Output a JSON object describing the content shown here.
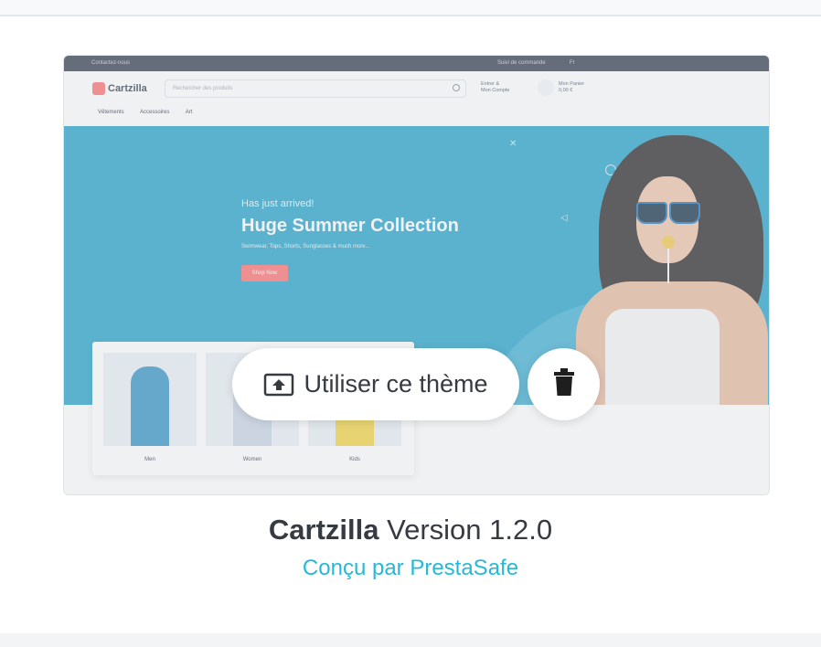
{
  "preview": {
    "topbar_left": "Contactez-nous",
    "topbar_track": "Suivi de commande",
    "topbar_lang": "Fr",
    "logo": "Cartzilla",
    "search_placeholder": "Rechercher des produits",
    "account_line1": "Entrer &",
    "account_line2": "Mon Compte",
    "cart_line1": "Mon Panier",
    "cart_line2": "0,00 €",
    "nav": [
      "Vêtements",
      "Accessoires",
      "Art"
    ],
    "hero": {
      "kicker": "Has just arrived!",
      "title": "Huge Summer Collection",
      "subtitle": "Swimwear, Tops, Shorts, Sunglasses & much more...",
      "button": "Shop Now"
    },
    "categories": [
      "Men",
      "Women",
      "Kids"
    ]
  },
  "actions": {
    "use_theme": "Utiliser ce thème",
    "delete_icon": "trash-icon",
    "use_icon": "upload-icon"
  },
  "theme": {
    "name": "Cartzilla",
    "version": "Version 1.2.0",
    "author": "Conçu par PrestaSafe"
  },
  "colors": {
    "accent": "#25b9d7",
    "text": "#363a41",
    "hero_bg": "#1c9fc6",
    "brand": "#fe696a"
  }
}
